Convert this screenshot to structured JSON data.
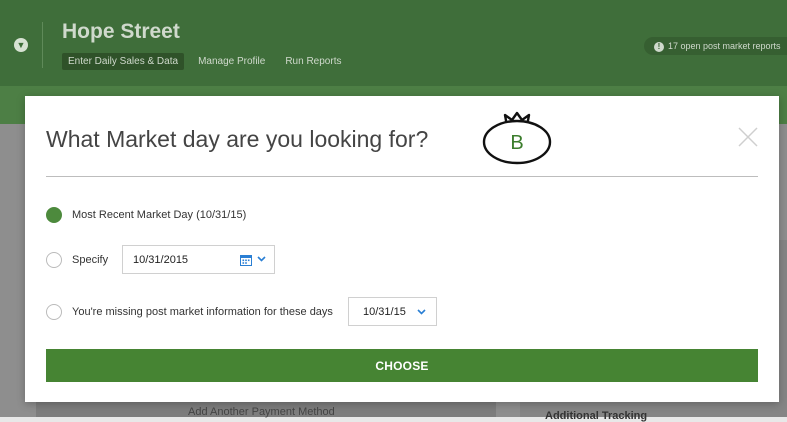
{
  "app": {
    "title": "Hope Street",
    "nav": [
      {
        "label": "Enter Daily Sales & Data",
        "active": true
      },
      {
        "label": "Manage Profile",
        "active": false
      },
      {
        "label": "Run Reports",
        "active": false
      }
    ],
    "open_reports": "17 open post market reports",
    "background_link": "Add Another Payment Method",
    "background_heading": "Additional Tracking"
  },
  "modal": {
    "title": "What Market day are you looking for?",
    "brand_letter": "B",
    "options": {
      "recent": "Most Recent Market Day (10/31/15)",
      "specify": "Specify",
      "missing": "You're missing post market information for these days"
    },
    "specify_date": "10/31/2015",
    "missing_selected": "10/31/15",
    "choose_label": "CHOOSE"
  },
  "colors": {
    "brand_green": "#468433",
    "header_green": "#3f6e3a"
  }
}
